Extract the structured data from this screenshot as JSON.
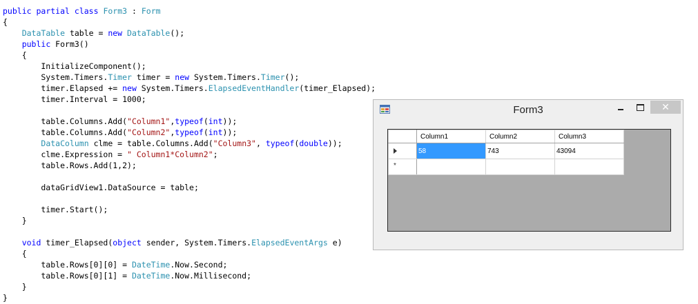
{
  "code": [
    [
      [
        "kw",
        "public"
      ],
      [
        "plain",
        " "
      ],
      [
        "kw",
        "partial"
      ],
      [
        "plain",
        " "
      ],
      [
        "kw",
        "class"
      ],
      [
        "plain",
        " "
      ],
      [
        "type",
        "Form3"
      ],
      [
        "plain",
        " : "
      ],
      [
        "type",
        "Form"
      ]
    ],
    [
      [
        "plain",
        "{"
      ]
    ],
    [
      [
        "plain",
        "    "
      ],
      [
        "type",
        "DataTable"
      ],
      [
        "plain",
        " table = "
      ],
      [
        "kw",
        "new"
      ],
      [
        "plain",
        " "
      ],
      [
        "type",
        "DataTable"
      ],
      [
        "plain",
        "();"
      ]
    ],
    [
      [
        "plain",
        "    "
      ],
      [
        "kw",
        "public"
      ],
      [
        "plain",
        " Form3()"
      ]
    ],
    [
      [
        "plain",
        "    {"
      ]
    ],
    [
      [
        "plain",
        "        InitializeComponent();"
      ]
    ],
    [
      [
        "plain",
        "        System.Timers."
      ],
      [
        "type",
        "Timer"
      ],
      [
        "plain",
        " timer = "
      ],
      [
        "kw",
        "new"
      ],
      [
        "plain",
        " System.Timers."
      ],
      [
        "type",
        "Timer"
      ],
      [
        "plain",
        "();"
      ]
    ],
    [
      [
        "plain",
        "        timer.Elapsed += "
      ],
      [
        "kw",
        "new"
      ],
      [
        "plain",
        " System.Timers."
      ],
      [
        "type",
        "ElapsedEventHandler"
      ],
      [
        "plain",
        "(timer_Elapsed);"
      ]
    ],
    [
      [
        "plain",
        "        timer.Interval = 1000;"
      ]
    ],
    [
      [
        "plain",
        ""
      ]
    ],
    [
      [
        "plain",
        "        table.Columns.Add("
      ],
      [
        "str",
        "\"Column1\""
      ],
      [
        "plain",
        ","
      ],
      [
        "kw",
        "typeof"
      ],
      [
        "plain",
        "("
      ],
      [
        "kw",
        "int"
      ],
      [
        "plain",
        "));"
      ]
    ],
    [
      [
        "plain",
        "        table.Columns.Add("
      ],
      [
        "str",
        "\"Column2\""
      ],
      [
        "plain",
        ","
      ],
      [
        "kw",
        "typeof"
      ],
      [
        "plain",
        "("
      ],
      [
        "kw",
        "int"
      ],
      [
        "plain",
        "));"
      ]
    ],
    [
      [
        "plain",
        "        "
      ],
      [
        "type",
        "DataColumn"
      ],
      [
        "plain",
        " clme = table.Columns.Add("
      ],
      [
        "str",
        "\"Column3\""
      ],
      [
        "plain",
        ", "
      ],
      [
        "kw",
        "typeof"
      ],
      [
        "plain",
        "("
      ],
      [
        "kw",
        "double"
      ],
      [
        "plain",
        "));"
      ]
    ],
    [
      [
        "plain",
        "        clme.Expression = "
      ],
      [
        "str",
        "\" Column1*Column2\""
      ],
      [
        "plain",
        ";"
      ]
    ],
    [
      [
        "plain",
        "        table.Rows.Add(1,2);"
      ]
    ],
    [
      [
        "plain",
        ""
      ]
    ],
    [
      [
        "plain",
        "        dataGridView1.DataSource = table;"
      ]
    ],
    [
      [
        "plain",
        ""
      ]
    ],
    [
      [
        "plain",
        "        timer.Start();"
      ]
    ],
    [
      [
        "plain",
        "    }"
      ]
    ],
    [
      [
        "plain",
        ""
      ]
    ],
    [
      [
        "plain",
        "    "
      ],
      [
        "kw",
        "void"
      ],
      [
        "plain",
        " timer_Elapsed("
      ],
      [
        "kw",
        "object"
      ],
      [
        "plain",
        " sender, System.Timers."
      ],
      [
        "type",
        "ElapsedEventArgs"
      ],
      [
        "plain",
        " e)"
      ]
    ],
    [
      [
        "plain",
        "    {"
      ]
    ],
    [
      [
        "plain",
        "        table.Rows[0][0] = "
      ],
      [
        "type",
        "DateTime"
      ],
      [
        "plain",
        ".Now.Second;"
      ]
    ],
    [
      [
        "plain",
        "        table.Rows[0][1] = "
      ],
      [
        "type",
        "DateTime"
      ],
      [
        "plain",
        ".Now.Millisecond;"
      ]
    ],
    [
      [
        "plain",
        "    }"
      ]
    ],
    [
      [
        "plain",
        "}"
      ]
    ]
  ],
  "window": {
    "title": "Form3",
    "icon": "winforms-app-icon",
    "minimize_icon": "minimize-icon",
    "maximize_icon": "maximize-icon",
    "close_icon": "close-icon",
    "close_label": "✕"
  },
  "grid": {
    "columns": [
      "Column1",
      "Column2",
      "Column3"
    ],
    "rows": [
      {
        "indicator": "current-row-arrow",
        "cells": [
          "58",
          "743",
          "43094"
        ],
        "selected_col": 0
      },
      {
        "indicator": "new-row-star",
        "indicator_text": "*",
        "cells": [
          "",
          "",
          ""
        ]
      }
    ]
  }
}
